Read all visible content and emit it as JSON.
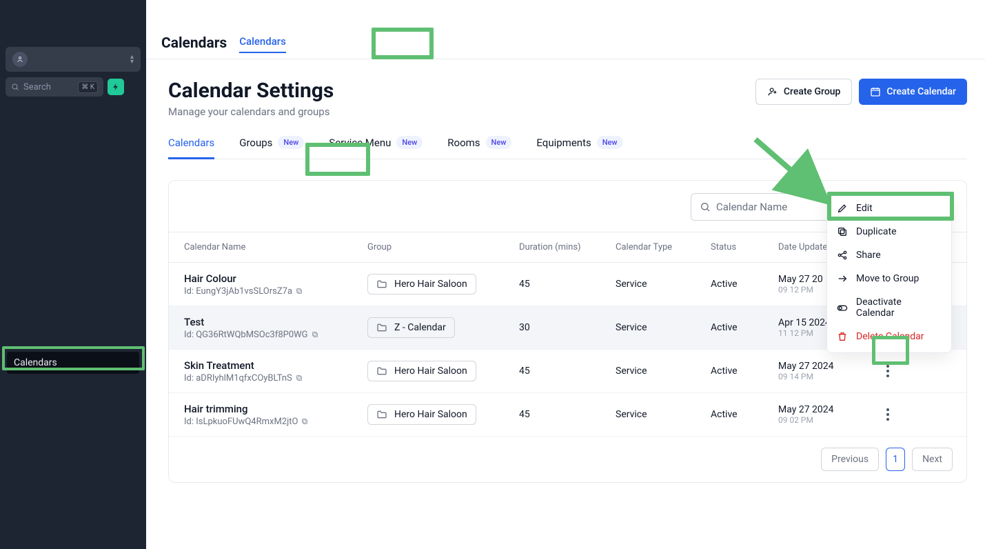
{
  "sidebar": {
    "search_placeholder": "Search",
    "search_shortcut": "⌘ K",
    "nav_item": "Calendars"
  },
  "header": {
    "title": "Calendars",
    "tab": "Calendars"
  },
  "page": {
    "title": "Calendar Settings",
    "subtitle": "Manage your calendars and groups",
    "create_group_label": "Create Group",
    "create_calendar_label": "Create Calendar"
  },
  "subtabs": [
    {
      "label": "Calendars",
      "badge": "",
      "active": true
    },
    {
      "label": "Groups",
      "badge": "New",
      "active": false
    },
    {
      "label": "Service Menu",
      "badge": "New",
      "active": false
    },
    {
      "label": "Rooms",
      "badge": "New",
      "active": false
    },
    {
      "label": "Equipments",
      "badge": "New",
      "active": false
    }
  ],
  "table": {
    "search_placeholder": "Calendar Name",
    "headers": {
      "name": "Calendar Name",
      "group": "Group",
      "duration": "Duration (mins)",
      "type": "Calendar Type",
      "status": "Status",
      "date": "Date Updated"
    },
    "rows": [
      {
        "name": "Hair Colour",
        "id": "Id: EungY3jAb1vsSLOrsZ7a",
        "group": "Hero Hair Saloon",
        "duration": "45",
        "type": "Service",
        "status": "Active",
        "date": "May 27 20",
        "time": "09 12 PM",
        "selected": false
      },
      {
        "name": "Test",
        "id": "Id: QG36RtWQbMSOc3f8P0WG",
        "group": "Z - Calendar",
        "duration": "30",
        "type": "Service",
        "status": "Active",
        "date": "Apr 15 2024",
        "time": "11 12 PM",
        "selected": true
      },
      {
        "name": "Skin Treatment",
        "id": "Id: aDRIyhlM1qfxCOyBLTnS",
        "group": "Hero Hair Saloon",
        "duration": "45",
        "type": "Service",
        "status": "Active",
        "date": "May 27 2024",
        "time": "09 14 PM",
        "selected": false
      },
      {
        "name": "Hair trimming",
        "id": "Id: IsLpkuoFUwQ4RmxM2jtO",
        "group": "Hero Hair Saloon",
        "duration": "45",
        "type": "Service",
        "status": "Active",
        "date": "May 27 2024",
        "time": "09 02 PM",
        "selected": false
      }
    ]
  },
  "context_menu": {
    "edit": "Edit",
    "duplicate": "Duplicate",
    "share": "Share",
    "move": "Move to Group",
    "deactivate": "Deactivate Calendar",
    "delete": "Delete Calendar"
  },
  "pagination": {
    "previous": "Previous",
    "current": "1",
    "next": "Next"
  }
}
